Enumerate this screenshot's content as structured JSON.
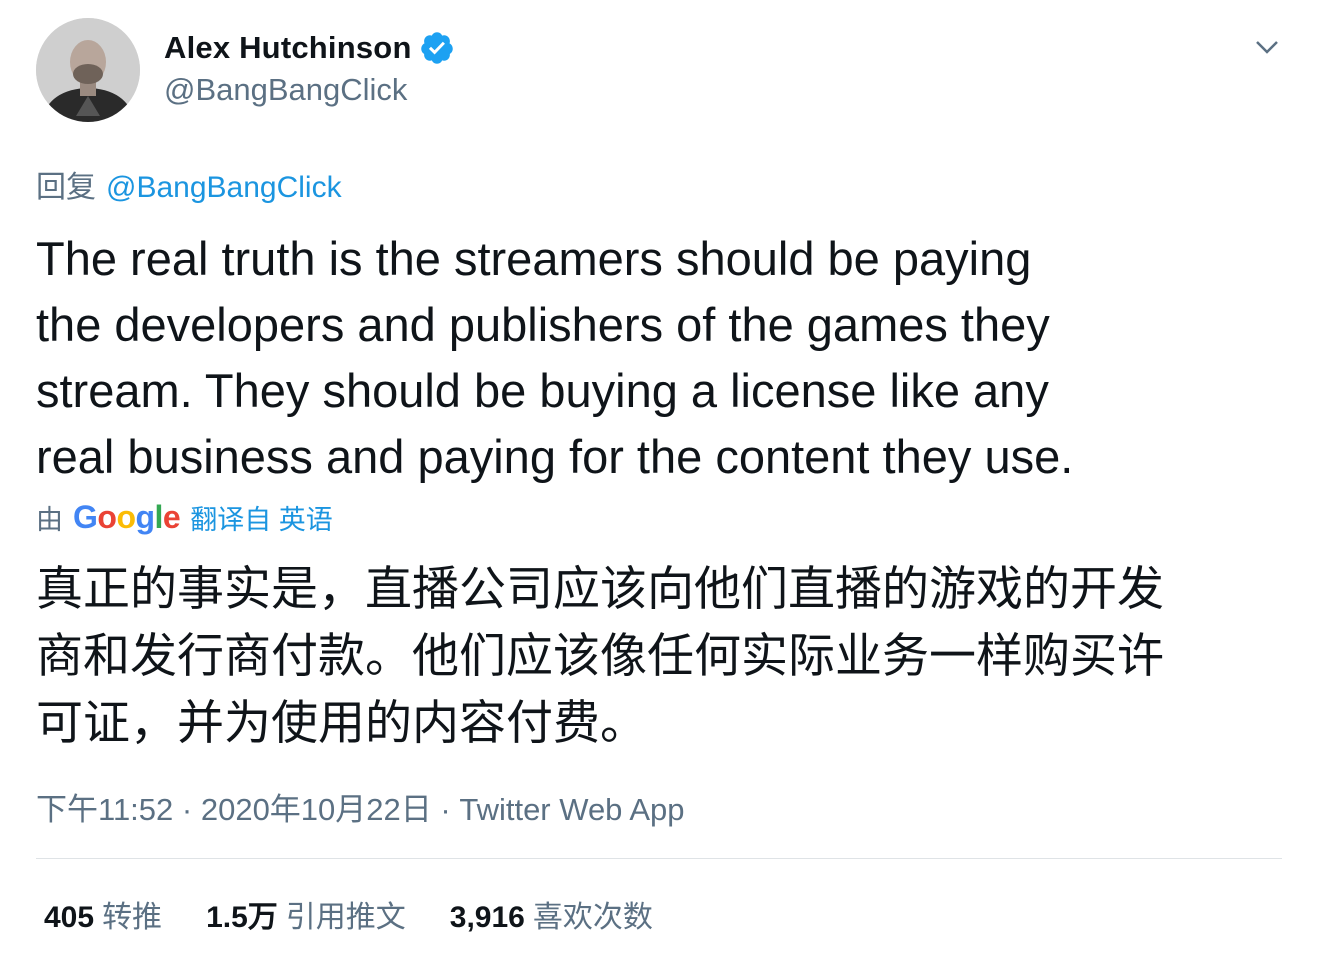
{
  "author": {
    "name": "Alex Hutchinson",
    "handle": "@BangBangClick",
    "verified": true
  },
  "reply": {
    "prefix": "回复",
    "to": "@BangBangClick"
  },
  "tweet": {
    "lines": [
      "The real truth is the streamers should be paying",
      "the developers and publishers of the games they",
      "stream. They should be buying a license like any",
      "real business and paying for the content they use."
    ]
  },
  "translation": {
    "by": "由",
    "provider": "Google",
    "label": "翻译自 英语",
    "lines": [
      "真正的事实是，直播公司应该向他们直播的游戏的开发",
      "商和发行商付款。他们应该像任何实际业务一样购买许",
      "可证，并为使用的内容付费。"
    ]
  },
  "meta": {
    "time": "下午11:52",
    "sep1": " · ",
    "date": "2020年10月22日",
    "sep2": " · ",
    "source": "Twitter Web App"
  },
  "stats": {
    "retweets": {
      "count": "405",
      "label": "转推"
    },
    "quotes": {
      "count": "1.5万",
      "label": "引用推文"
    },
    "likes": {
      "count": "3,916",
      "label": "喜欢次数"
    }
  },
  "colors": {
    "accent": "#1b95e0",
    "secondary_text": "#5b7083",
    "primary_text": "#0f1419",
    "verified_badge": "#1da1f2"
  },
  "icons": [
    "avatar-photo",
    "verified-badge-icon",
    "chevron-down-icon"
  ]
}
